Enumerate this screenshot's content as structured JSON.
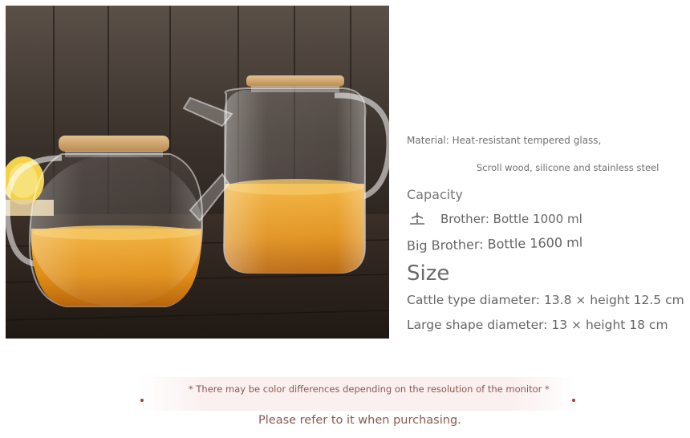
{
  "photo": {
    "icon": "glass-teapots-photo"
  },
  "spec": {
    "material_line1": "Material: Heat-resistant tempered glass,",
    "material_line2": "Scroll wood, silicone and stainless steel",
    "capacity_heading": "Capacity",
    "small_icon": "small-size-icon",
    "brother": "Brother: Bottle 1000 ml",
    "big_brother": "Big Brother: Bottle 1600 ml",
    "size_heading": "Size",
    "cattle_dim": "Cattle type diameter: 13.8 × height 12.5 cm",
    "large_dim": "Large shape diameter: 13 × height 18 cm"
  },
  "notes": {
    "color_note": "* There may be color differences depending on the resolution of the monitor *",
    "purchase_note": "Please refer to it when purchasing."
  },
  "colors": {
    "tea": "#e0921a",
    "wood": "#3a302a",
    "bamboo": "#d9b07a",
    "note_text": "#8a5a52",
    "accent_dot": "#b03838"
  }
}
